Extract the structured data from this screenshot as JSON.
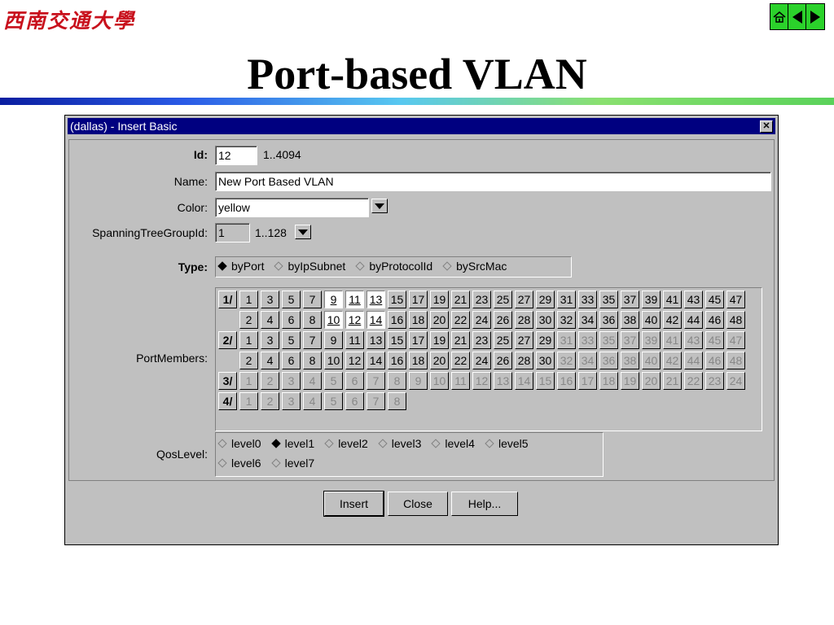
{
  "slide": {
    "logo_text": "西南交通大學",
    "title": "Port-based VLAN",
    "nav": [
      {
        "name": "home-icon"
      },
      {
        "name": "prev-arrow-icon"
      },
      {
        "name": "next-arrow-icon"
      }
    ]
  },
  "dialog": {
    "title": "(dallas) - Insert Basic",
    "close_glyph": "✕",
    "id": {
      "label": "Id:",
      "value": "12",
      "range": "1..4094"
    },
    "name": {
      "label": "Name:",
      "value": "New Port Based VLAN"
    },
    "color": {
      "label": "Color:",
      "value": "yellow"
    },
    "stg": {
      "label": "SpanningTreeGroupId:",
      "value": "1",
      "range": "1..128"
    },
    "type": {
      "label": "Type:",
      "options": [
        {
          "label": "byPort",
          "selected": true
        },
        {
          "label": "byIpSubnet",
          "selected": false
        },
        {
          "label": "byProtocolId",
          "selected": false
        },
        {
          "label": "bySrcMac",
          "selected": false
        }
      ]
    },
    "port_members": {
      "label": "PortMembers:",
      "slots": [
        {
          "slot": "1/",
          "rows": [
            [
              "1",
              "3",
              "5",
              "7",
              "9",
              "11",
              "13",
              "15",
              "17",
              "19",
              "21",
              "23",
              "25",
              "27",
              "29",
              "31",
              "33",
              "35",
              "37",
              "39",
              "41",
              "43",
              "45",
              "47"
            ],
            [
              "2",
              "4",
              "6",
              "8",
              "10",
              "12",
              "14",
              "16",
              "18",
              "20",
              "22",
              "24",
              "26",
              "28",
              "30",
              "32",
              "34",
              "36",
              "38",
              "40",
              "42",
              "44",
              "46",
              "48"
            ]
          ],
          "selected": [
            "9",
            "11",
            "13",
            "10",
            "12",
            "14"
          ],
          "disabled_from": null
        },
        {
          "slot": "2/",
          "rows": [
            [
              "1",
              "3",
              "5",
              "7",
              "9",
              "11",
              "13",
              "15",
              "17",
              "19",
              "21",
              "23",
              "25",
              "27",
              "29",
              "31",
              "33",
              "35",
              "37",
              "39",
              "41",
              "43",
              "45",
              "47"
            ],
            [
              "2",
              "4",
              "6",
              "8",
              "10",
              "12",
              "14",
              "16",
              "18",
              "20",
              "22",
              "24",
              "26",
              "28",
              "30",
              "32",
              "34",
              "36",
              "38",
              "40",
              "42",
              "44",
              "46",
              "48"
            ]
          ],
          "selected": [],
          "disabled_from": 31
        },
        {
          "slot": "3/",
          "rows": [
            [
              "1",
              "2",
              "3",
              "4",
              "5",
              "6",
              "7",
              "8",
              "9",
              "10",
              "11",
              "12",
              "13",
              "14",
              "15",
              "16",
              "17",
              "18",
              "19",
              "20",
              "21",
              "22",
              "23",
              "24"
            ]
          ],
          "selected": [],
          "disabled_from": 1
        },
        {
          "slot": "4/",
          "rows": [
            [
              "1",
              "2",
              "3",
              "4",
              "5",
              "6",
              "7",
              "8"
            ]
          ],
          "selected": [],
          "disabled_from": 1
        }
      ]
    },
    "qos": {
      "label": "QosLevel:",
      "row1": [
        {
          "label": "level0",
          "selected": false
        },
        {
          "label": "level1",
          "selected": true
        },
        {
          "label": "level2",
          "selected": false
        },
        {
          "label": "level3",
          "selected": false
        },
        {
          "label": "level4",
          "selected": false
        },
        {
          "label": "level5",
          "selected": false
        }
      ],
      "row2": [
        {
          "label": "level6",
          "selected": false
        },
        {
          "label": "level7",
          "selected": false
        }
      ]
    },
    "buttons": {
      "insert": "Insert",
      "close": "Close",
      "help": "Help..."
    }
  }
}
